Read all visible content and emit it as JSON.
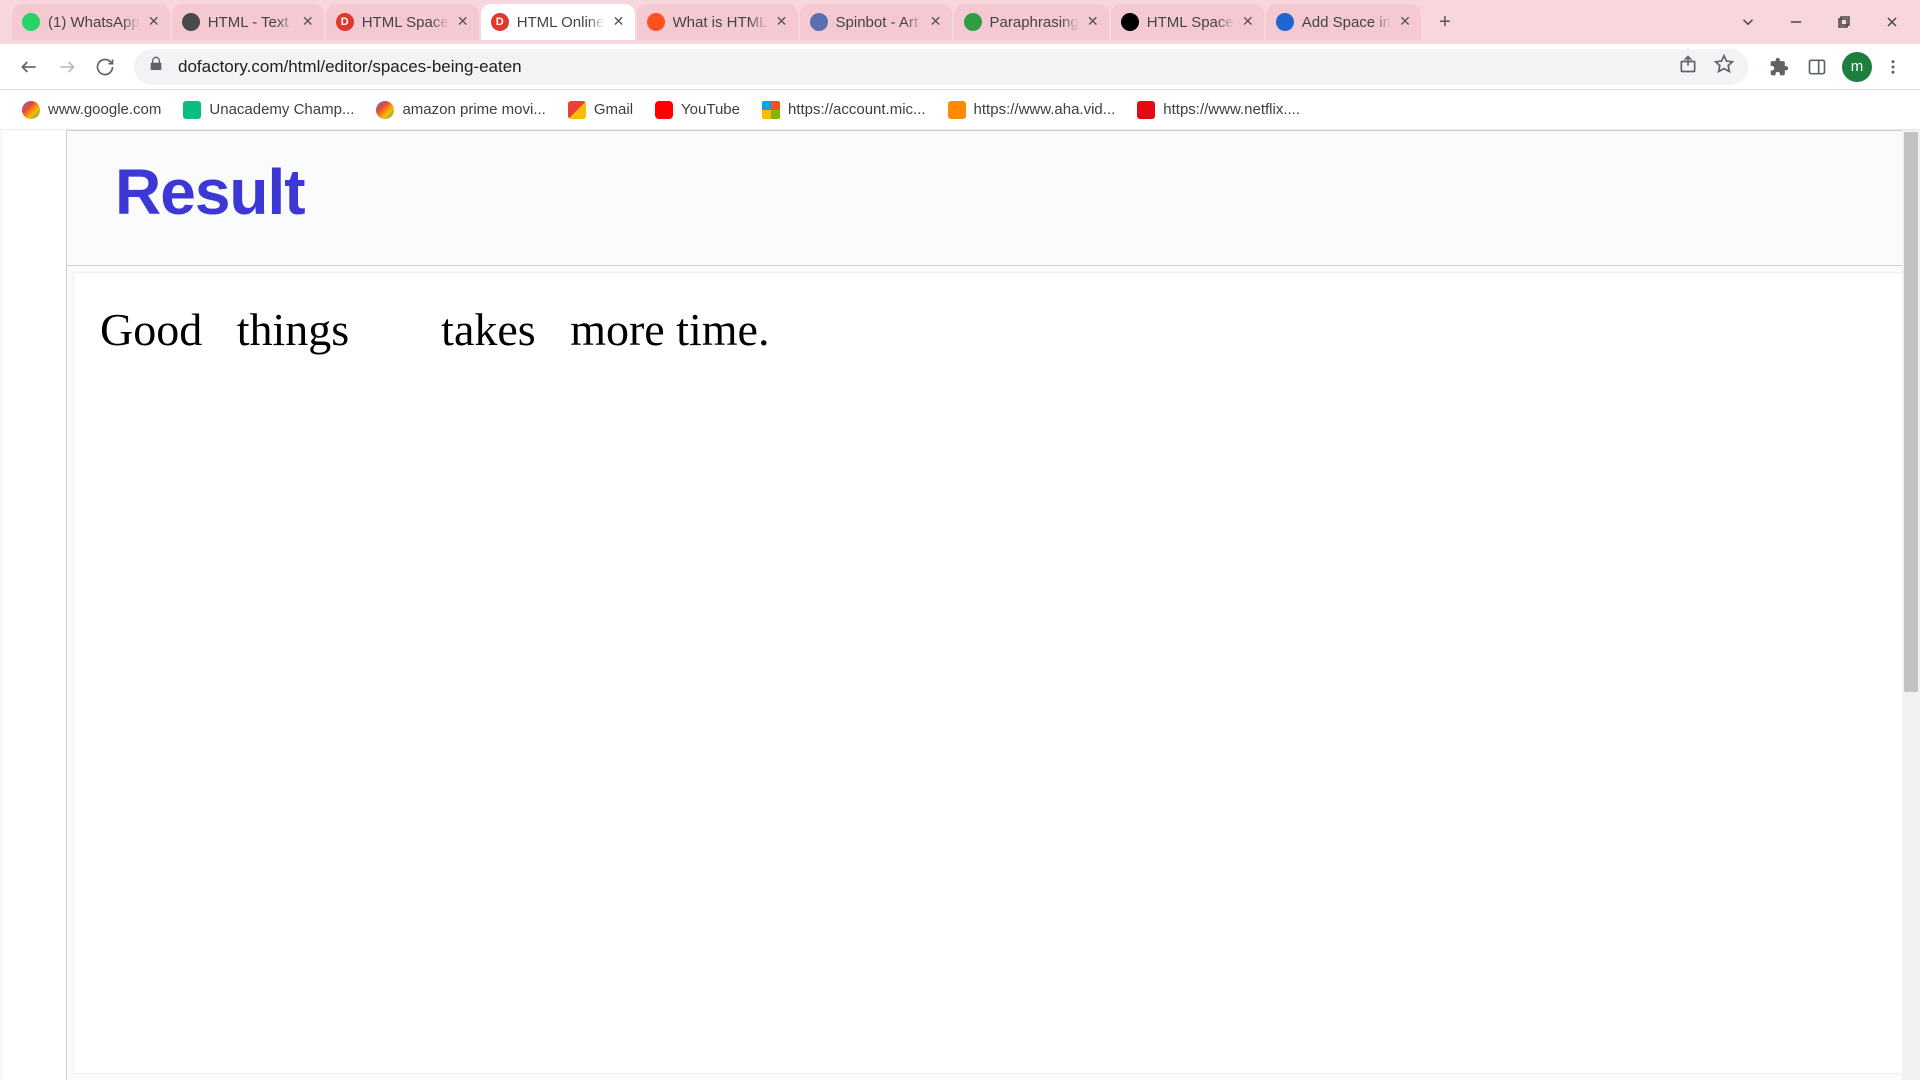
{
  "browser": {
    "tabs": [
      {
        "title": "(1) WhatsApp",
        "favicon_bg": "#25D366",
        "favicon_text": "",
        "active": false
      },
      {
        "title": "HTML - Text",
        "favicon_bg": "#4a4a4a",
        "favicon_text": "",
        "active": false
      },
      {
        "title": "HTML Space",
        "favicon_bg": "#e0382c",
        "favicon_text": "D",
        "active": false
      },
      {
        "title": "HTML Online",
        "favicon_bg": "#e0382c",
        "favicon_text": "D",
        "active": true
      },
      {
        "title": "What is HTML",
        "favicon_bg": "#ff4f1f",
        "favicon_text": "",
        "active": false
      },
      {
        "title": "Spinbot - Art",
        "favicon_bg": "#5a6fb0",
        "favicon_text": "",
        "active": false
      },
      {
        "title": "Paraphrasing",
        "favicon_bg": "#2f9e44",
        "favicon_text": "",
        "active": false
      },
      {
        "title": "HTML Space",
        "favicon_bg": "#000000",
        "favicon_text": "",
        "active": false
      },
      {
        "title": "Add Space in",
        "favicon_bg": "#1e66d0",
        "favicon_text": "",
        "active": false
      }
    ],
    "url": "dofactory.com/html/editor/spaces-being-eaten",
    "avatar_initial": "m",
    "bookmarks": [
      {
        "label": "www.google.com",
        "icon_bg": "#ffffff",
        "icon_letter": "G"
      },
      {
        "label": "Unacademy Champ...",
        "icon_bg": "#ffffff",
        "icon_letter": "▲"
      },
      {
        "label": "amazon prime movi...",
        "icon_bg": "#ffffff",
        "icon_letter": "G"
      },
      {
        "label": "Gmail",
        "icon_bg": "#ffffff",
        "icon_letter": "M"
      },
      {
        "label": "YouTube",
        "icon_bg": "#ff0000",
        "icon_letter": "▶"
      },
      {
        "label": "https://account.mic...",
        "icon_bg": "#ffffff",
        "icon_letter": "⊞"
      },
      {
        "label": "https://www.aha.vid...",
        "icon_bg": "#ff8c00",
        "icon_letter": "a"
      },
      {
        "label": "https://www.netflix....",
        "icon_bg": "#e50914",
        "icon_letter": "N"
      }
    ]
  },
  "page": {
    "result_heading": "Result",
    "result_body": "Good   things        takes   more time."
  }
}
